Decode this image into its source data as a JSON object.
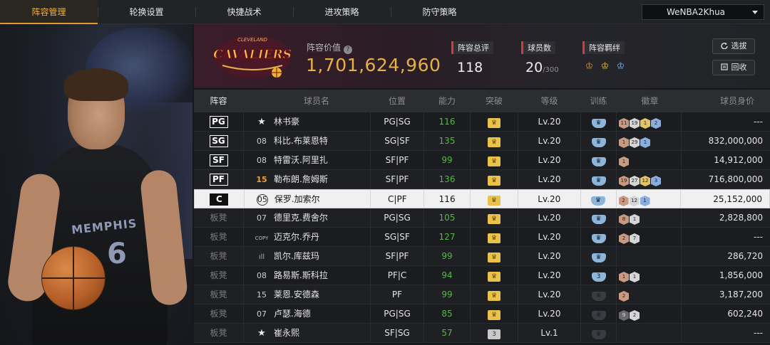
{
  "tabs": [
    {
      "label": "阵容管理",
      "active": true
    },
    {
      "label": "轮换设置",
      "active": false
    },
    {
      "label": "快捷战术",
      "active": false
    },
    {
      "label": "进攻策略",
      "active": false
    },
    {
      "label": "防守策略",
      "active": false
    }
  ],
  "account": {
    "name": "WeNBA2Khua"
  },
  "player_panel": {
    "jersey_team": "MEMPHIS",
    "jersey_number": "6"
  },
  "team": {
    "logo_text": "CAVALIERS",
    "logo_small": "CLEVELAND",
    "value_label": "阵容价值",
    "value": "1,701,624,960",
    "overall_label": "阵容总评",
    "overall": "118",
    "count_label": "球员数",
    "count": "20",
    "count_max": "/300",
    "bond_label": "阵容羁绊",
    "bond_colors": [
      "#c98a5a",
      "#e7c24a",
      "#7fb0e0"
    ]
  },
  "buttons": {
    "pick": "选拔",
    "recycle": "回收"
  },
  "columns": [
    "阵容",
    "球员名",
    "位置",
    "能力",
    "突破",
    "等级",
    "训练",
    "徽章",
    "球员身价"
  ],
  "rows": [
    {
      "slot": "PG",
      "starter": true,
      "num": "★",
      "numtype": "star",
      "name": "林书豪",
      "pos": "PG|SG",
      "ability": "116",
      "crown": "gold",
      "level": "Lv.20",
      "train": "blue",
      "badges": [
        [
          "11",
          "bronze"
        ],
        [
          "19",
          "silver"
        ],
        [
          "1",
          "gold"
        ],
        [
          "2",
          "blue"
        ]
      ],
      "salary": "---"
    },
    {
      "slot": "SG",
      "starter": true,
      "num": "08",
      "numtype": "",
      "name": "科比.布莱恩特",
      "pos": "SG|SF",
      "ability": "135",
      "crown": "gold",
      "level": "Lv.20",
      "train": "blue",
      "badges": [
        [
          "1",
          "bronze"
        ],
        [
          "29",
          "silver"
        ],
        [
          "1",
          "blue"
        ]
      ],
      "salary": "832,000,000"
    },
    {
      "slot": "SF",
      "starter": true,
      "num": "08",
      "numtype": "",
      "name": "特雷沃.阿里扎",
      "pos": "SF|PF",
      "ability": "99",
      "crown": "gold",
      "level": "Lv.20",
      "train": "blue",
      "badges": [
        [
          "1",
          "bronze"
        ]
      ],
      "salary": "14,912,000"
    },
    {
      "slot": "PF",
      "starter": true,
      "num": "15",
      "numtype": "orange",
      "name": "勒布朗.詹姆斯",
      "pos": "SF|PF",
      "ability": "136",
      "crown": "gold",
      "level": "Lv.20",
      "train": "blue",
      "badges": [
        [
          "19",
          "bronze"
        ],
        [
          "27",
          "silver"
        ],
        [
          "12",
          "gold"
        ],
        [
          "3",
          "blue"
        ]
      ],
      "salary": "716,800,000"
    },
    {
      "slot": "C",
      "starter": true,
      "selected": true,
      "num": "05",
      "numtype": "circ",
      "name": "保罗.加索尔",
      "pos": "C|PF",
      "ability": "116",
      "crown": "gold",
      "level": "Lv.20",
      "train": "blue",
      "badges": [
        [
          "2",
          "bronze"
        ],
        [
          "12",
          "silver"
        ],
        [
          "1",
          "blue"
        ]
      ],
      "salary": "25,152,000"
    },
    {
      "slot": "板凳",
      "starter": false,
      "num": "07",
      "numtype": "",
      "name": "德里克.费舍尔",
      "pos": "PG|SG",
      "ability": "105",
      "crown": "gold",
      "level": "Lv.20",
      "train": "blue",
      "badges": [
        [
          "8",
          "bronze"
        ],
        [
          "1",
          "silver"
        ]
      ],
      "salary": "2,828,800"
    },
    {
      "slot": "板凳",
      "starter": false,
      "num": "COPY",
      "numtype": "copy",
      "name": "迈克尔.乔丹",
      "pos": "SG|SF",
      "ability": "127",
      "crown": "gold",
      "level": "Lv.20",
      "train": "blue",
      "badges": [
        [
          "2",
          "bronze"
        ],
        [
          "7",
          "silver"
        ]
      ],
      "salary": "---"
    },
    {
      "slot": "板凳",
      "starter": false,
      "num": "ıll",
      "numtype": "bars",
      "name": "凯尔.库兹玛",
      "pos": "SF|PF",
      "ability": "99",
      "crown": "gold",
      "level": "Lv.20",
      "train": "blue",
      "badges": [],
      "salary": "286,720"
    },
    {
      "slot": "板凳",
      "starter": false,
      "num": "08",
      "numtype": "",
      "name": "路易斯.斯科拉",
      "pos": "PF|C",
      "ability": "94",
      "crown": "gold",
      "level": "Lv.20",
      "train": "blue3",
      "badges": [
        [
          "1",
          "bronze"
        ],
        [
          "1",
          "silver"
        ]
      ],
      "salary": "1,856,000"
    },
    {
      "slot": "板凳",
      "starter": false,
      "num": "15",
      "numtype": "",
      "name": "莱恩.安德森",
      "pos": "PF",
      "ability": "99",
      "crown": "gold",
      "level": "Lv.20",
      "train": "gray",
      "badges": [
        [
          "2",
          "bronze"
        ]
      ],
      "salary": "3,187,200"
    },
    {
      "slot": "板凳",
      "starter": false,
      "num": "07",
      "numtype": "",
      "name": "卢瑟.海德",
      "pos": "PG|SG",
      "ability": "85",
      "crown": "gold",
      "level": "Lv.20",
      "train": "gray",
      "badges": [
        [
          "9",
          "dark"
        ],
        [
          "2",
          "silver"
        ]
      ],
      "salary": "602,240"
    },
    {
      "slot": "板凳",
      "starter": false,
      "num": "★",
      "numtype": "star",
      "name": "崔永熙",
      "pos": "SF|SG",
      "ability": "57",
      "crown": "gray3",
      "level": "Lv.1",
      "train": "gray",
      "badges": [],
      "salary": "---"
    }
  ]
}
